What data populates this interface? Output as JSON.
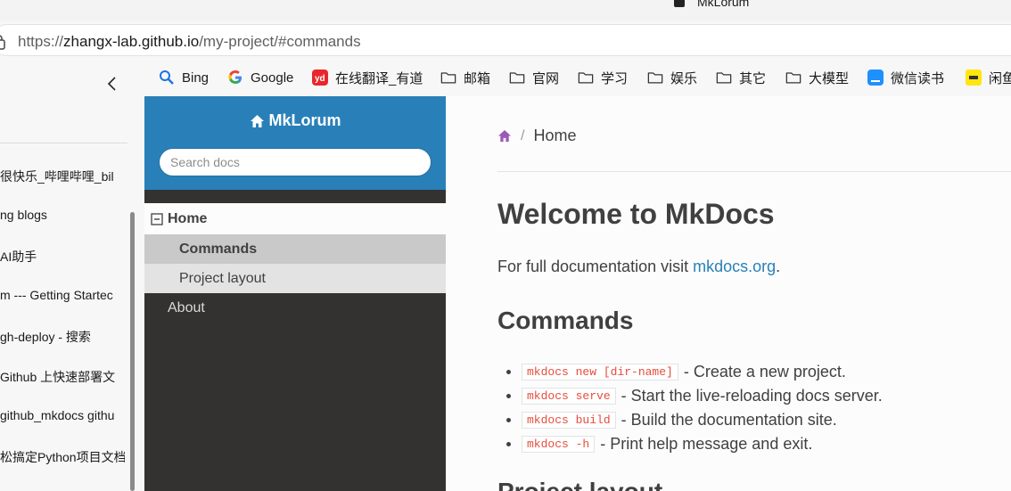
{
  "browser": {
    "window_title": "MkLorum",
    "url_protocol": "https://",
    "url_host": "zhangx-lab.github.io",
    "url_path": "/my-project/#commands"
  },
  "bookmarks": [
    {
      "label": "Bing",
      "icon": "search-icon"
    },
    {
      "label": "Google",
      "icon": "google-icon"
    },
    {
      "label": "在线翻译_有道",
      "icon": "youdao-icon"
    },
    {
      "label": "邮箱",
      "icon": "folder-icon"
    },
    {
      "label": "官网",
      "icon": "folder-icon"
    },
    {
      "label": "学习",
      "icon": "folder-icon"
    },
    {
      "label": "娱乐",
      "icon": "folder-icon"
    },
    {
      "label": "其它",
      "icon": "folder-icon"
    },
    {
      "label": "大模型",
      "icon": "folder-icon"
    },
    {
      "label": "微信读书",
      "icon": "weread-icon"
    },
    {
      "label": "闲鱼",
      "icon": "xianyu-icon"
    }
  ],
  "history_sidebar": {
    "items": [
      "很快乐_哔哩哔哩_bil",
      "ng blogs",
      "AI助手",
      "m --- Getting Startec",
      "gh-deploy - 搜索",
      " Github 上快速部署文",
      "github_mkdocs githu",
      "松搞定Python项目文档"
    ]
  },
  "site": {
    "brand": "MkLorum",
    "search_placeholder": "Search docs",
    "nav": {
      "home": "Home",
      "commands": "Commands",
      "project_layout": "Project layout",
      "about": "About"
    }
  },
  "content": {
    "breadcrumb_current": "Home",
    "breadcrumb_sep": "/",
    "title": "Welcome to MkDocs",
    "intro_prefix": "For full documentation visit ",
    "intro_link": "mkdocs.org",
    "intro_suffix": ".",
    "commands_heading": "Commands",
    "commands": [
      {
        "code": "mkdocs new [dir-name]",
        "desc": " - Create a new project."
      },
      {
        "code": "mkdocs serve",
        "desc": " - Start the live-reloading docs server."
      },
      {
        "code": "mkdocs build",
        "desc": " - Build the documentation site."
      },
      {
        "code": "mkdocs -h",
        "desc": " - Print help message and exit."
      }
    ],
    "next_heading": "Project layout"
  },
  "colors": {
    "accent": "#2980b9",
    "nav_bg": "#343131",
    "code_red": "#e74c3c",
    "breadcrumb_home": "#9b59b6"
  }
}
